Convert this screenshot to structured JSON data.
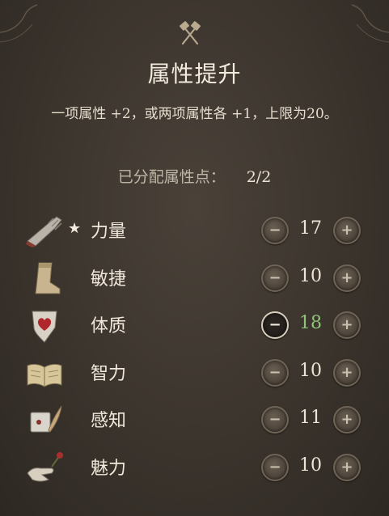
{
  "panel": {
    "title": "属性提升",
    "description": "一项属性 +2，或两项属性各 +1，上限为20。",
    "points_label": "已分配属性点：",
    "points_value": "2/2"
  },
  "buttons": {
    "minus": "−",
    "plus": "+"
  },
  "attributes": [
    {
      "name": "力量",
      "value": "17",
      "starred": "★",
      "icon": "gauntlet-icon",
      "changed": false
    },
    {
      "name": "敏捷",
      "value": "10",
      "starred": "",
      "icon": "boot-icon",
      "changed": false
    },
    {
      "name": "体质",
      "value": "18",
      "starred": "",
      "icon": "heart-shield-icon",
      "changed": true
    },
    {
      "name": "智力",
      "value": "10",
      "starred": "",
      "icon": "open-book-icon",
      "changed": false
    },
    {
      "name": "感知",
      "value": "11",
      "starred": "",
      "icon": "feather-scroll-icon",
      "changed": false
    },
    {
      "name": "魅力",
      "value": "10",
      "starred": "",
      "icon": "hand-flower-icon",
      "changed": false
    }
  ],
  "colors": {
    "changed_value": "#8fc57a",
    "background": "#3b342d"
  }
}
